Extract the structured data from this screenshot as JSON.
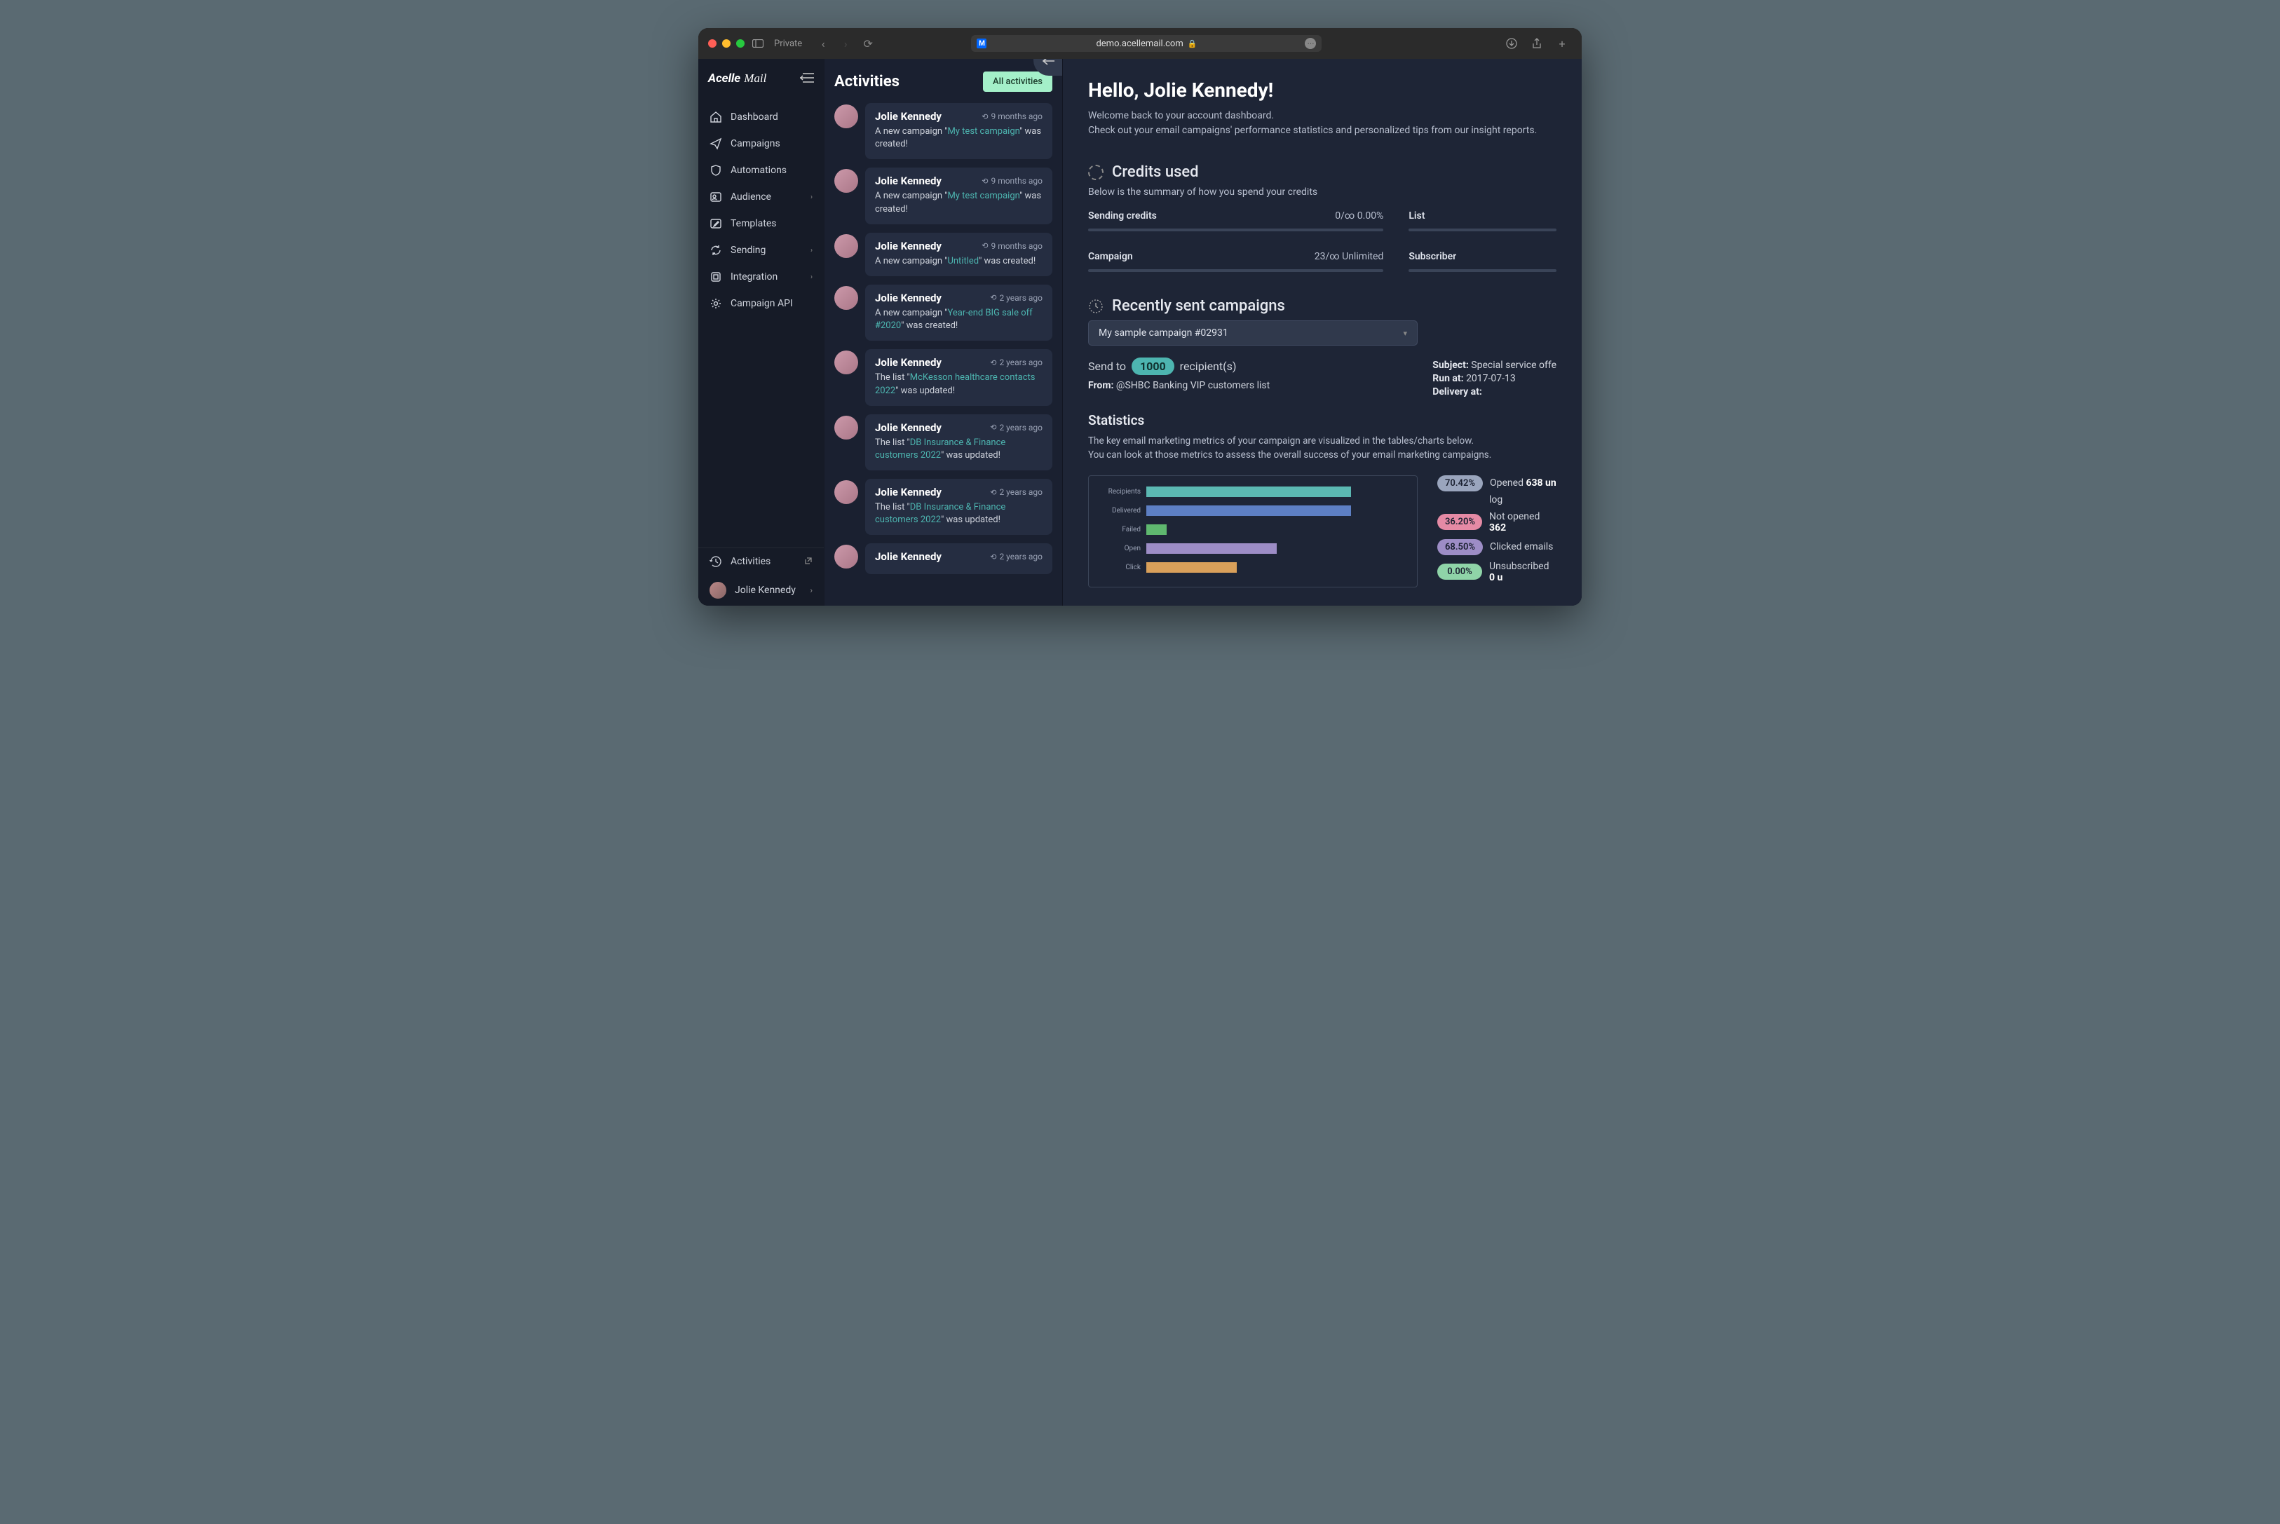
{
  "browser": {
    "private_label": "Private",
    "url": "demo.acellemail.com"
  },
  "logo": {
    "part1": "Acelle",
    "part2": "Mail"
  },
  "nav": [
    {
      "icon": "home-icon",
      "label": "Dashboard",
      "caret": false
    },
    {
      "icon": "send-icon",
      "label": "Campaigns",
      "caret": false
    },
    {
      "icon": "shield-icon",
      "label": "Automations",
      "caret": false
    },
    {
      "icon": "users-icon",
      "label": "Audience",
      "caret": true
    },
    {
      "icon": "edit-icon",
      "label": "Templates",
      "caret": false
    },
    {
      "icon": "sync-icon",
      "label": "Sending",
      "caret": true
    },
    {
      "icon": "plug-icon",
      "label": "Integration",
      "caret": true
    },
    {
      "icon": "gear-icon",
      "label": "Campaign API",
      "caret": false
    }
  ],
  "footer": {
    "activities_label": "Activities",
    "user_name": "Jolie Kennedy"
  },
  "activities": {
    "title": "Activities",
    "all_button": "All activities",
    "items": [
      {
        "name": "Jolie Kennedy",
        "time": "9 months ago",
        "prefix": "A new campaign \"",
        "link": "My test campaign",
        "suffix": "\" was created!"
      },
      {
        "name": "Jolie Kennedy",
        "time": "9 months ago",
        "prefix": "A new campaign \"",
        "link": "My test campaign",
        "suffix": "\" was created!"
      },
      {
        "name": "Jolie Kennedy",
        "time": "9 months ago",
        "prefix": "A new campaign \"",
        "link": "Untitled",
        "suffix": "\" was created!"
      },
      {
        "name": "Jolie Kennedy",
        "time": "2 years ago",
        "prefix": "A new campaign \"",
        "link": "Year-end BIG sale off #2020",
        "suffix": "\" was created!"
      },
      {
        "name": "Jolie Kennedy",
        "time": "2 years ago",
        "prefix": "The list \"",
        "link": "McKesson healthcare contacts 2022",
        "suffix": "\" was updated!"
      },
      {
        "name": "Jolie Kennedy",
        "time": "2 years ago",
        "prefix": "The list \"",
        "link": "DB Insurance & Finance customers 2022",
        "suffix": "\" was updated!"
      },
      {
        "name": "Jolie Kennedy",
        "time": "2 years ago",
        "prefix": "The list \"",
        "link": "DB Insurance & Finance customers 2022",
        "suffix": "\" was updated!"
      },
      {
        "name": "Jolie Kennedy",
        "time": "2 years ago",
        "prefix": "",
        "link": "",
        "suffix": ""
      }
    ]
  },
  "main": {
    "hello": "Hello, Jolie Kennedy!",
    "welcome1": "Welcome back to your account dashboard.",
    "welcome2": "Check out your email campaigns' performance statistics and personalized tips from our insight reports.",
    "credits": {
      "title": "Credits used",
      "subtitle": "Below is the summary of how you spend your credits",
      "blocks": [
        {
          "label": "Sending credits",
          "value": "0/∞    0.00%"
        },
        {
          "label": "List",
          "value": ""
        },
        {
          "label": "Campaign",
          "value": "23/∞    Unlimited"
        },
        {
          "label": "Subscriber",
          "value": ""
        }
      ]
    },
    "recent": {
      "title": "Recently sent campaigns",
      "selected": "My sample campaign #02931",
      "send_to_prefix": "Send to",
      "recipients_count": "1000",
      "send_to_suffix": "recipient(s)",
      "from_label": "From:",
      "from_value": "@SHBC Banking VIP customers list",
      "subject_label": "Subject:",
      "subject_value": "Special service offe",
      "run_at_label": "Run at:",
      "run_at_value": "2017-07-13",
      "delivery_label": "Delivery at:",
      "delivery_value": ""
    },
    "statistics": {
      "title": "Statistics",
      "desc1": "The key email marketing metrics of your campaign are visualized in the tables/charts below.",
      "desc2": "You can look at those metrics to assess the overall success of your email marketing campaigns.",
      "legend": [
        {
          "pct": "70.42%",
          "color": "#9aa5bd",
          "text_prefix": "Opened ",
          "strong": "638 un",
          "link": "log"
        },
        {
          "pct": "36.20%",
          "color": "#e58aa5",
          "text_prefix": "Not opened ",
          "strong": "362",
          "link": ""
        },
        {
          "pct": "68.50%",
          "color": "#9d8dc6",
          "text_prefix": "Clicked emails",
          "strong": "",
          "link": ""
        },
        {
          "pct": "0.00%",
          "color": "#8fd4a8",
          "text_prefix": "Unsubscribed ",
          "strong": "0 u",
          "link": ""
        }
      ]
    }
  },
  "chart_data": {
    "type": "bar",
    "orientation": "horizontal",
    "categories": [
      "Recipients",
      "Delivered",
      "Failed",
      "Open",
      "Click"
    ],
    "values": [
      1000,
      1000,
      100,
      638,
      440
    ],
    "colors": [
      "#5bb8b2",
      "#5d7fc4",
      "#5fb86f",
      "#9d8dc6",
      "#d9a05a"
    ],
    "xlim": [
      0,
      1300
    ],
    "title": "",
    "xlabel": "",
    "ylabel": ""
  }
}
